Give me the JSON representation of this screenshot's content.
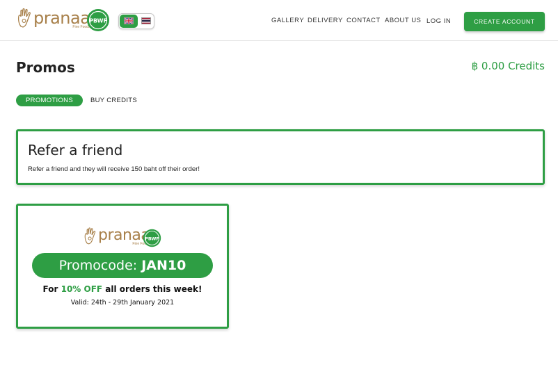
{
  "brand": {
    "name": "pranaa",
    "tagline": "Fine Foods",
    "badge_text": "PBWF",
    "accent_color": "#2e9e44",
    "logo_color": "#a8804a"
  },
  "language": {
    "options": [
      "English",
      "Thai"
    ],
    "selected": "English",
    "icons": [
      "uk-flag-icon",
      "thailand-flag-icon"
    ]
  },
  "nav": {
    "items": [
      "GALLERY",
      "DELIVERY",
      "CONTACT",
      "ABOUT US",
      "LOG IN"
    ],
    "create_account": "CREATE ACCOUNT"
  },
  "page": {
    "title": "Promos",
    "credits": "฿ 0.00 Credits"
  },
  "tabs": {
    "active": "PROMOTIONS",
    "other": "BUY CREDITS"
  },
  "refer": {
    "title": "Refer a friend",
    "text": "Refer a friend and they will receive 150 baht off their order!"
  },
  "promo": {
    "code_label": "Promocode:",
    "code": "JAN10",
    "offer_prefix": "For",
    "offer_highlight": "10% OFF",
    "offer_suffix": "all orders this week!",
    "valid": "Valid: 24th - 29th January 2021"
  }
}
